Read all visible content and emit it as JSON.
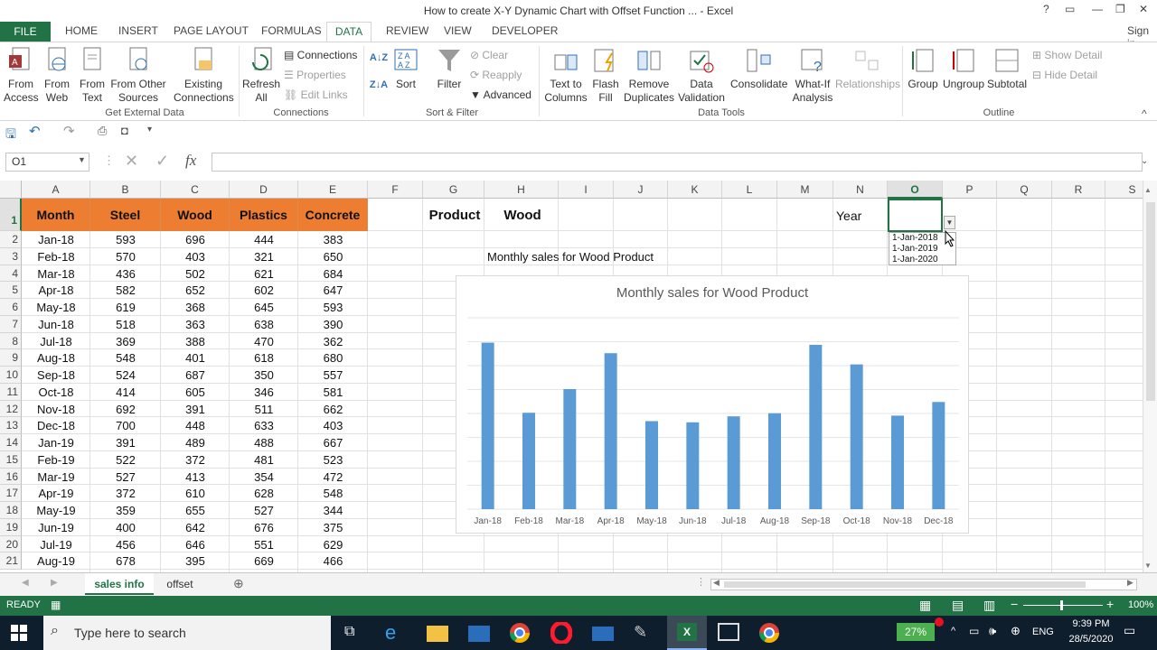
{
  "window": {
    "title": "How to create X-Y Dynamic Chart with Offset Function ... - Excel",
    "help": "?",
    "signin": "Sign in"
  },
  "ribbon_tabs": [
    "FILE",
    "HOME",
    "INSERT",
    "PAGE LAYOUT",
    "FORMULAS",
    "DATA",
    "REVIEW",
    "VIEW",
    "DEVELOPER"
  ],
  "ribbon": {
    "get_external": {
      "from_access": [
        "From",
        "Access"
      ],
      "from_web": [
        "From",
        "Web"
      ],
      "from_text": [
        "From",
        "Text"
      ],
      "from_other": [
        "From Other",
        "Sources"
      ],
      "existing": [
        "Existing",
        "Connections"
      ],
      "label": "Get External Data"
    },
    "connections": {
      "refresh": [
        "Refresh",
        "All"
      ],
      "connections": "Connections",
      "properties": "Properties",
      "edit_links": "Edit Links",
      "label": "Connections"
    },
    "sort_filter": {
      "sort": "Sort",
      "filter": "Filter",
      "clear": "Clear",
      "reapply": "Reapply",
      "advanced": "Advanced",
      "label": "Sort & Filter"
    },
    "data_tools": {
      "text_to_columns": [
        "Text to",
        "Columns"
      ],
      "flash_fill": [
        "Flash",
        "Fill"
      ],
      "remove_dup": [
        "Remove",
        "Duplicates"
      ],
      "validation": [
        "Data",
        "Validation"
      ],
      "consolidate": "Consolidate",
      "whatif": [
        "What-If",
        "Analysis"
      ],
      "relationships": "Relationships",
      "label": "Data Tools"
    },
    "outline": {
      "group": "Group",
      "ungroup": "Ungroup",
      "subtotal": "Subtotal",
      "show_detail": "Show Detail",
      "hide_detail": "Hide Detail",
      "label": "Outline"
    }
  },
  "namebox": "O1",
  "columns": [
    "A",
    "B",
    "C",
    "D",
    "E",
    "F",
    "G",
    "H",
    "I",
    "J",
    "K",
    "L",
    "M",
    "N",
    "O",
    "P",
    "Q",
    "R",
    "S"
  ],
  "table": {
    "headers": [
      "Month",
      "Steel",
      "Wood",
      "Plastics",
      "Concrete"
    ],
    "rows": [
      [
        "Jan-18",
        "593",
        "696",
        "444",
        "383"
      ],
      [
        "Feb-18",
        "570",
        "403",
        "321",
        "650"
      ],
      [
        "Mar-18",
        "436",
        "502",
        "621",
        "684"
      ],
      [
        "Apr-18",
        "582",
        "652",
        "602",
        "647"
      ],
      [
        "May-18",
        "619",
        "368",
        "645",
        "593"
      ],
      [
        "Jun-18",
        "518",
        "363",
        "638",
        "390"
      ],
      [
        "Jul-18",
        "369",
        "388",
        "470",
        "362"
      ],
      [
        "Aug-18",
        "548",
        "401",
        "618",
        "680"
      ],
      [
        "Sep-18",
        "524",
        "687",
        "350",
        "557"
      ],
      [
        "Oct-18",
        "414",
        "605",
        "346",
        "581"
      ],
      [
        "Nov-18",
        "692",
        "391",
        "511",
        "662"
      ],
      [
        "Dec-18",
        "700",
        "448",
        "633",
        "403"
      ],
      [
        "Jan-19",
        "391",
        "489",
        "488",
        "667"
      ],
      [
        "Feb-19",
        "522",
        "372",
        "481",
        "523"
      ],
      [
        "Mar-19",
        "527",
        "413",
        "354",
        "472"
      ],
      [
        "Apr-19",
        "372",
        "610",
        "628",
        "548"
      ],
      [
        "May-19",
        "359",
        "655",
        "527",
        "344"
      ],
      [
        "Jun-19",
        "400",
        "642",
        "676",
        "375"
      ],
      [
        "Jul-19",
        "456",
        "646",
        "551",
        "629"
      ],
      [
        "Aug-19",
        "678",
        "395",
        "669",
        "466"
      ]
    ]
  },
  "product_label": "Product",
  "product_value": "Wood",
  "year_label": "Year",
  "chart_caption": "Monthly sales for Wood Product",
  "dropdown_options": [
    "1-Jan-2018",
    "1-Jan-2019",
    "1-Jan-2020"
  ],
  "chart_data": {
    "type": "bar",
    "title": "Monthly sales for Wood Product",
    "categories": [
      "Jan-18",
      "Feb-18",
      "Mar-18",
      "Apr-18",
      "May-18",
      "Jun-18",
      "Jul-18",
      "Aug-18",
      "Sep-18",
      "Oct-18",
      "Nov-18",
      "Dec-18"
    ],
    "values": [
      696,
      403,
      502,
      652,
      368,
      363,
      388,
      401,
      687,
      605,
      391,
      448
    ],
    "ylim": [
      0,
      800
    ],
    "grid": true,
    "color": "#5b9bd5"
  },
  "sheet_tabs": [
    "sales info",
    "offset"
  ],
  "status": {
    "ready": "READY",
    "zoom": "100%"
  },
  "taskbar": {
    "search": "Type here to search",
    "battery": "27%",
    "lang": "ENG",
    "time": "9:39 PM",
    "date": "28/5/2020"
  },
  "colors": {
    "excel_green": "#217346",
    "header_orange": "#ed7d31",
    "bar_blue": "#5b9bd5"
  }
}
